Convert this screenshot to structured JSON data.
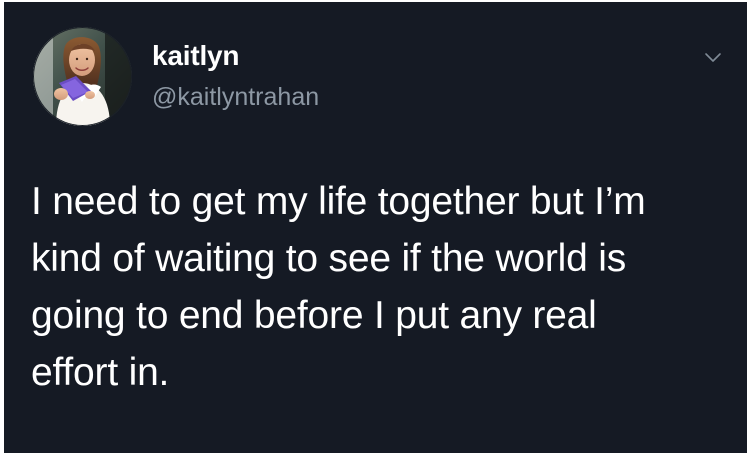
{
  "tweet": {
    "display_name": "kaitlyn",
    "handle": "@kaitlyntrahan",
    "text": "I need to get my life together but I’m\nkind of waiting to see if the world is\ngoing to end before I put any real\neffort in."
  },
  "icons": {
    "avatar": "profile-photo",
    "menu": "chevron-down-icon"
  },
  "colors": {
    "background": "#151a24",
    "primary_text": "#ffffff",
    "secondary_text": "#8d98a4",
    "chevron": "#7f8a96"
  }
}
